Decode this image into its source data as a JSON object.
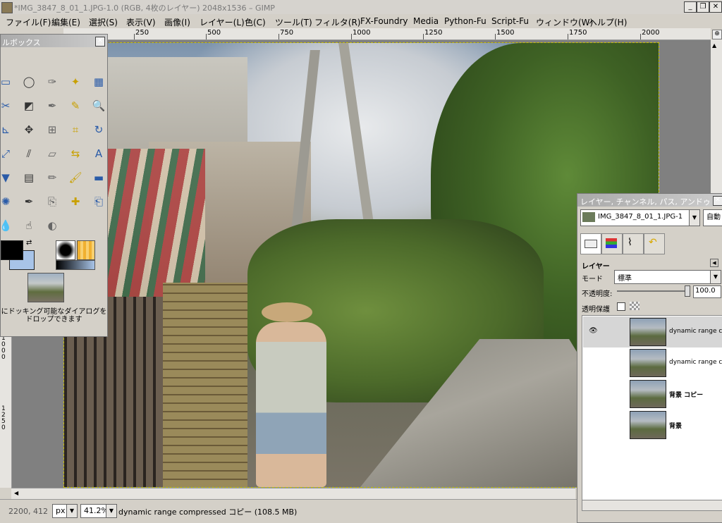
{
  "window": {
    "title": "*IMG_3847_8_01_1.JPG-1.0 (RGB, 4枚のレイヤー) 2048x1536 – GIMP",
    "min_label": "_",
    "max_label": "❐",
    "close_label": "✕"
  },
  "menu": [
    "ファイル(F)",
    "編集(E)",
    "選択(S)",
    "表示(V)",
    "画像(I)",
    "レイヤー(L)",
    "色(C)",
    "ツール(T)",
    "フィルタ(R)",
    "FX-Foundry",
    "Media",
    "Python-Fu",
    "Script-Fu",
    "ウィンドウ(W)",
    "ヘルプ(H)"
  ],
  "ruler_top": [
    "250",
    "500",
    "750",
    "1000",
    "1250",
    "1500",
    "1750",
    "2000"
  ],
  "ruler_left": [
    "1000",
    "1250"
  ],
  "toolbox": {
    "title": "ルボックス",
    "drop_note": "にドッキング可能なダイアログをドロップできます",
    "fg_color": "#000000",
    "bg_color": "#a8c4e8",
    "tool_icons": [
      "rect-select-icon",
      "ellipse-select-icon",
      "lasso-icon",
      "fuzzy-select-icon",
      "color-select-icon",
      "scissors-icon",
      "foreground-select-icon",
      "paths-icon",
      "color-picker-icon",
      "zoom-icon",
      "measure-icon",
      "move-icon",
      "align-icon",
      "crop-icon",
      "rotate-icon",
      "scale-icon",
      "shear-icon",
      "perspective-icon",
      "flip-icon",
      "text-icon",
      "bucket-fill-icon",
      "blend-icon",
      "pencil-icon",
      "paintbrush-icon",
      "eraser-icon",
      "airbrush-icon",
      "ink-icon",
      "clone-icon",
      "heal-icon",
      "perspective-clone-icon",
      "blur-icon",
      "smudge-icon",
      "dodge-burn-icon"
    ]
  },
  "status": {
    "coords": "2200, 412",
    "unit": "px",
    "zoom": "41.2%",
    "message": "dynamic range compressed コピー (108.5 MB)"
  },
  "layers_panel": {
    "title": "レイヤー, チャンネル, パス, アンドゥ",
    "image_select": "IMG_3847_8_01_1.JPG-1",
    "auto_label": "自動",
    "section_label": "レイヤー",
    "mode_label": "モード",
    "mode_value": "標準",
    "opacity_label": "不透明度:",
    "opacity_value": "100.0",
    "lock_label": "透明保護",
    "layers": [
      {
        "name": "dynamic range compressed",
        "visible": true
      },
      {
        "name": "dynamic range co",
        "visible": false
      },
      {
        "name": "背景 コピー",
        "visible": false
      },
      {
        "name": "背景",
        "visible": false
      }
    ]
  }
}
